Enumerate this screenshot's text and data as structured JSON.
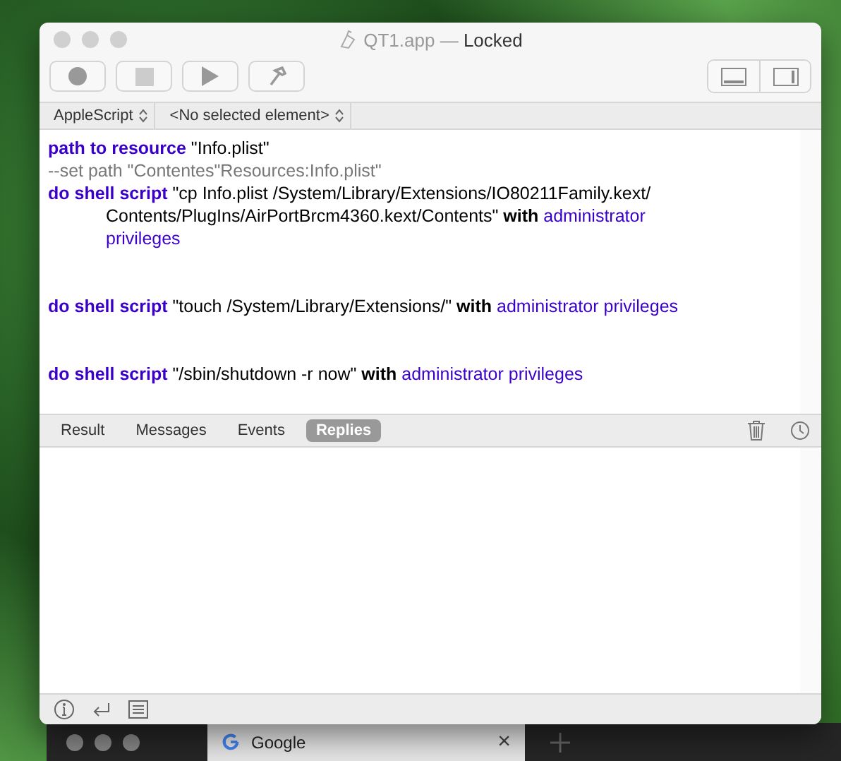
{
  "window": {
    "title": "QT1.app",
    "separator": "—",
    "status": "Locked"
  },
  "toolbar": {
    "buttons": [
      {
        "kind": "record"
      },
      {
        "kind": "stop"
      },
      {
        "kind": "run"
      },
      {
        "kind": "compile"
      }
    ],
    "view_buttons": [
      {
        "kind": "bottom"
      },
      {
        "kind": "side"
      }
    ]
  },
  "navigation_bar": {
    "language": "AppleScript",
    "element": "<No selected element>"
  },
  "script_lines": [
    {
      "kind": "code",
      "segments": [
        {
          "kind": "keyword",
          "text": "path to resource"
        },
        {
          "kind": "string",
          "text": " \"Info.plist\""
        }
      ]
    },
    {
      "kind": "code",
      "segments": [
        {
          "kind": "comment",
          "text": "--set path \"Contentes\"Resources:Info.plist\""
        }
      ]
    },
    {
      "kind": "code",
      "segments": [
        {
          "kind": "keyword",
          "text": "do shell script"
        },
        {
          "kind": "string",
          "text": " \"cp Info.plist /System/Library/Extensions/IO80211Family.kext/"
        }
      ]
    },
    {
      "kind": "wrap",
      "segments": [
        {
          "kind": "string",
          "text": "Contents/PlugIns/AirPortBrcm4360.kext/Contents\" "
        },
        {
          "kind": "bold",
          "text": "with"
        },
        {
          "kind": "param",
          "text": " administrator"
        }
      ]
    },
    {
      "kind": "wrap",
      "segments": [
        {
          "kind": "param",
          "text": "privileges"
        }
      ]
    },
    {
      "kind": "blank"
    },
    {
      "kind": "blank"
    },
    {
      "kind": "code",
      "segments": [
        {
          "kind": "keyword",
          "text": "do shell script"
        },
        {
          "kind": "string",
          "text": " \"touch /System/Library/Extensions/\" "
        },
        {
          "kind": "bold",
          "text": "with"
        },
        {
          "kind": "param",
          "text": " administrator privileges"
        }
      ]
    },
    {
      "kind": "blank"
    },
    {
      "kind": "blank"
    },
    {
      "kind": "code",
      "segments": [
        {
          "kind": "keyword",
          "text": "do shell script"
        },
        {
          "kind": "string",
          "text": " \"/sbin/shutdown -r now\" "
        },
        {
          "kind": "bold",
          "text": "with"
        },
        {
          "kind": "param",
          "text": " administrator privileges"
        }
      ]
    }
  ],
  "result_tabs": [
    {
      "label": "Result",
      "selected": false
    },
    {
      "label": "Messages",
      "selected": false
    },
    {
      "label": "Events",
      "selected": false
    },
    {
      "label": "Replies",
      "selected": true
    }
  ],
  "browser_behind": {
    "tab": {
      "label": "Google",
      "close": "×"
    }
  }
}
